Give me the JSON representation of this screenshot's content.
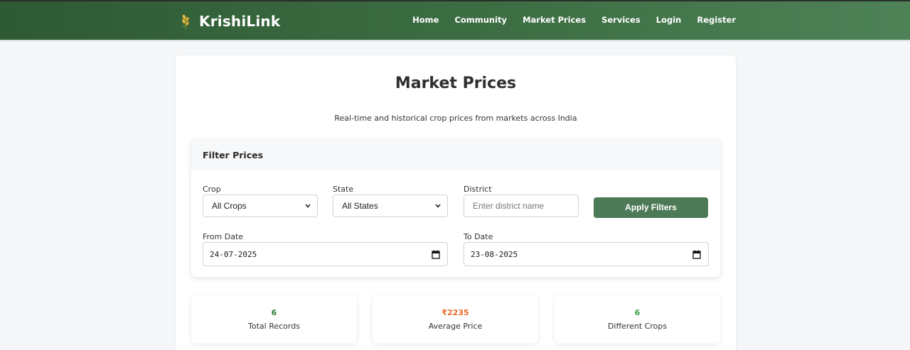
{
  "nav": {
    "brand": "KrishiLink",
    "links": [
      "Home",
      "Community",
      "Market Prices",
      "Services",
      "Login",
      "Register"
    ]
  },
  "page": {
    "title": "Market Prices",
    "subtitle": "Real-time and historical crop prices from markets across India"
  },
  "filter": {
    "header": "Filter Prices",
    "crop_label": "Crop",
    "crop_value": "All Crops",
    "state_label": "State",
    "state_value": "All States",
    "district_label": "District",
    "district_placeholder": "Enter district name",
    "apply_label": "Apply Filters",
    "from_label": "From Date",
    "from_value": "24-07-2025",
    "to_label": "To Date",
    "to_value": "23-08-2025"
  },
  "stats": [
    {
      "value": "6",
      "label": "Total Records",
      "color": "#2e7d32"
    },
    {
      "value": "₹2235",
      "label": "Average Price",
      "color": "#e86a2c"
    },
    {
      "value": "6",
      "label": "Different Crops",
      "color": "#3aa04a"
    }
  ],
  "colors": {
    "nav_start": "#2e5a33",
    "nav_end": "#4e8257",
    "button": "#4d7a56"
  }
}
